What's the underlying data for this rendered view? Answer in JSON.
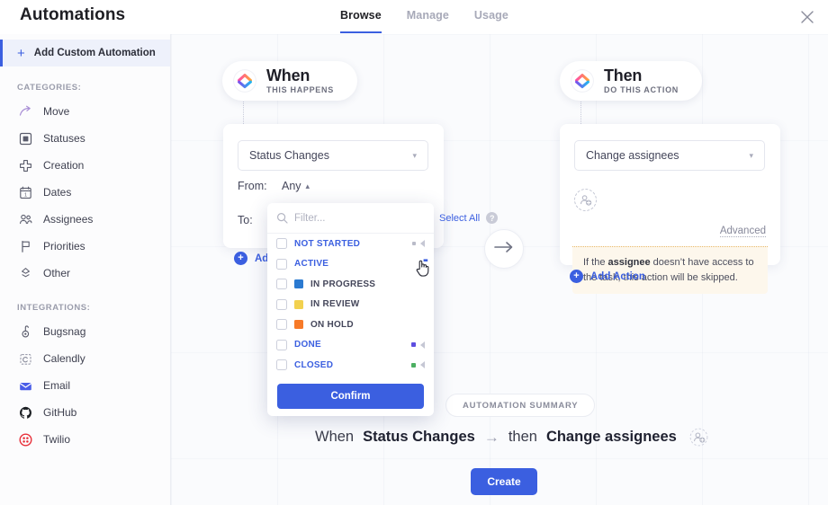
{
  "header": {
    "title": "Automations",
    "tabs": [
      {
        "label": "Browse",
        "active": true
      },
      {
        "label": "Manage",
        "active": false
      },
      {
        "label": "Usage",
        "active": false
      }
    ],
    "close_icon": "close-icon"
  },
  "sidebar": {
    "add_custom_label": "Add Custom Automation",
    "add_custom_icon": "plus-icon",
    "categories_label": "CATEGORIES:",
    "categories": [
      {
        "label": "Move",
        "icon": "move-arrow-icon"
      },
      {
        "label": "Statuses",
        "icon": "status-square-icon"
      },
      {
        "label": "Creation",
        "icon": "plus-cross-icon"
      },
      {
        "label": "Dates",
        "icon": "calendar-icon"
      },
      {
        "label": "Assignees",
        "icon": "people-icon"
      },
      {
        "label": "Priorities",
        "icon": "flag-icon"
      },
      {
        "label": "Other",
        "icon": "diamond-icon"
      }
    ],
    "integrations_label": "INTEGRATIONS:",
    "integrations": [
      {
        "label": "Bugsnag",
        "icon": "bugsnag-icon"
      },
      {
        "label": "Calendly",
        "icon": "calendly-icon"
      },
      {
        "label": "Email",
        "icon": "email-icon"
      },
      {
        "label": "GitHub",
        "icon": "github-icon"
      },
      {
        "label": "Twilio",
        "icon": "twilio-icon"
      }
    ]
  },
  "when_card": {
    "pill_title": "When",
    "pill_subtitle": "THIS HAPPENS",
    "trigger_value": "Status Changes",
    "from_label": "From:",
    "from_value": "Any",
    "to_label": "To:",
    "add_trigger_label": "Add Trigger"
  },
  "then_card": {
    "pill_title": "Then",
    "pill_subtitle": "DO THIS ACTION",
    "action_value": "Change assignees",
    "advanced_label": "Advanced",
    "warning_prefix": "If the ",
    "warning_bold": "assignee",
    "warning_suffix": " doesn’t have access to the task, this action will be skipped.",
    "add_action_label": "Add Action",
    "avatar_icon": "add-assignee-icon"
  },
  "status_dropdown": {
    "filter_placeholder": "Filter...",
    "filter_value": "",
    "select_all_label": "Select All",
    "search_icon": "search-icon",
    "help_icon": "help-icon",
    "confirm_label": "Confirm",
    "items": [
      {
        "label": "NOT STARTED",
        "color": "#3b5fe0",
        "swatch": null,
        "is_group": true,
        "group_dot": "#b9bbc8"
      },
      {
        "label": "ACTIVE",
        "color": "#3b5fe0",
        "swatch": null,
        "is_group": true,
        "group_dot": null
      },
      {
        "label": "IN PROGRESS",
        "color": "#44465a",
        "swatch": "#2b7ad1",
        "is_group": false,
        "group_dot": null
      },
      {
        "label": "IN REVIEW",
        "color": "#44465a",
        "swatch": "#f2d14f",
        "is_group": false,
        "group_dot": null
      },
      {
        "label": "ON HOLD",
        "color": "#44465a",
        "swatch": "#f77a28",
        "is_group": false,
        "group_dot": null
      },
      {
        "label": "DONE",
        "color": "#3b5fe0",
        "swatch": null,
        "is_group": true,
        "group_dot": "#5d4ee0"
      },
      {
        "label": "CLOSED",
        "color": "#3b5fe0",
        "swatch": null,
        "is_group": true,
        "group_dot": "#4caf62"
      }
    ]
  },
  "summary": {
    "pill_label": "AUTOMATION SUMMARY",
    "when_word": "When",
    "trigger": "Status Changes",
    "arrow": "→",
    "then_word": "then",
    "action": "Change assignees",
    "create_label": "Create",
    "avatar_icon": "add-assignee-icon"
  },
  "flow": {
    "arrow_icon": "arrow-right-icon"
  },
  "colors": {
    "accent": "#3b5fe0",
    "canvas_bg": "#fafbfd",
    "warn_bg": "#fdf7ec"
  }
}
